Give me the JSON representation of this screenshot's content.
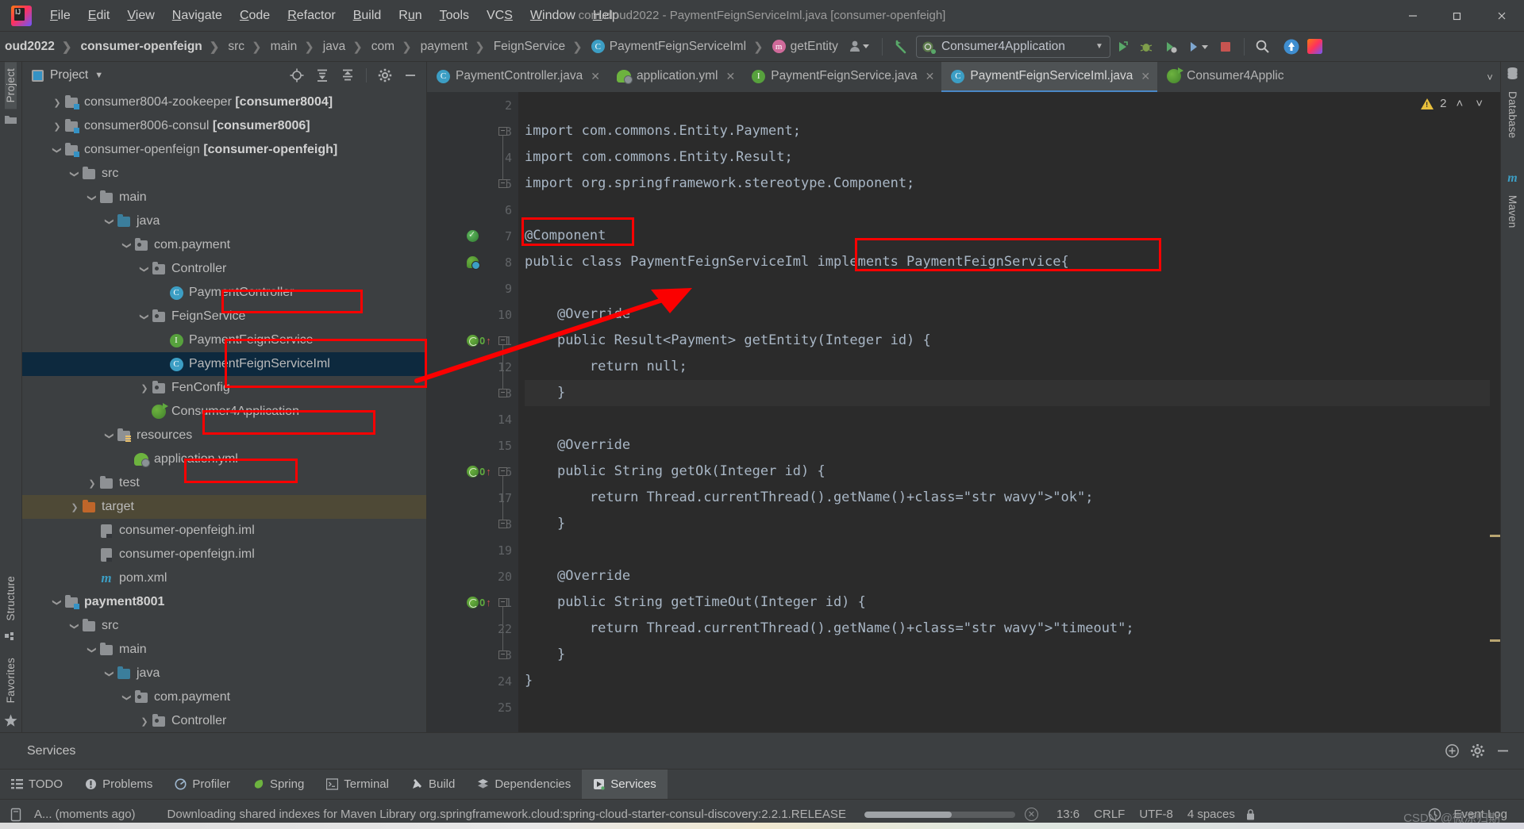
{
  "window": {
    "title": "com.cloud2022 - PaymentFeignServiceIml.java [consumer-openfeigh]",
    "minimize": "—",
    "maximize": "❐",
    "close": "✕"
  },
  "menu": {
    "items": [
      {
        "label": "File"
      },
      {
        "label": "Edit"
      },
      {
        "label": "View"
      },
      {
        "label": "Navigate"
      },
      {
        "label": "Code"
      },
      {
        "label": "Refactor"
      },
      {
        "label": "Build"
      },
      {
        "label": "Run"
      },
      {
        "label": "Tools"
      },
      {
        "label": "VCS"
      },
      {
        "label": "Window"
      },
      {
        "label": "Help"
      }
    ]
  },
  "breadcrumbs": [
    {
      "label": "oud2022",
      "bold": true,
      "icon": null
    },
    {
      "label": "consumer-openfeign",
      "bold": true,
      "icon": null
    },
    {
      "label": "src",
      "bold": false,
      "icon": null
    },
    {
      "label": "main",
      "bold": false,
      "icon": null
    },
    {
      "label": "java",
      "bold": false,
      "icon": null
    },
    {
      "label": "com",
      "bold": false,
      "icon": null
    },
    {
      "label": "payment",
      "bold": false,
      "icon": null
    },
    {
      "label": "FeignService",
      "bold": false,
      "icon": null
    },
    {
      "label": "PaymentFeignServiceIml",
      "bold": false,
      "icon": "class-icon"
    },
    {
      "label": "getEntity",
      "bold": false,
      "icon": "method-icon"
    }
  ],
  "toolbar": {
    "run_config": "Consumer4Application",
    "run_config_caret": "▼",
    "icons": [
      "user-icon",
      "back-arrow-icon",
      "run-icon",
      "debug-icon",
      "coverage-icon",
      "profile-icon",
      "stop-icon",
      "search-icon",
      "update-icon",
      "ide-icon"
    ]
  },
  "project_panel": {
    "title": "Project",
    "caret": "▼",
    "header_icons": [
      "locate-icon",
      "expand-all-icon",
      "collapse-all-icon",
      "gear-icon",
      "hide-icon"
    ],
    "tree": [
      {
        "depth": 1,
        "arrow": "collapsed",
        "icon": "module-icon",
        "label": "consumer8004-zookeeper ",
        "bold_suffix": "[consumer8004]"
      },
      {
        "depth": 1,
        "arrow": "collapsed",
        "icon": "module-icon",
        "label": "consumer8006-consul ",
        "bold_suffix": "[consumer8006]"
      },
      {
        "depth": 1,
        "arrow": "expanded",
        "icon": "module-icon",
        "label": "consumer-openfeign ",
        "bold_suffix": "[consumer-openfeigh]"
      },
      {
        "depth": 2,
        "arrow": "expanded",
        "icon": "folder-icon",
        "label": "src"
      },
      {
        "depth": 3,
        "arrow": "expanded",
        "icon": "folder-icon",
        "label": "main"
      },
      {
        "depth": 4,
        "arrow": "expanded",
        "icon": "source-folder-icon",
        "label": "java"
      },
      {
        "depth": 5,
        "arrow": "expanded",
        "icon": "package-icon",
        "label": "com.payment"
      },
      {
        "depth": 6,
        "arrow": "expanded",
        "icon": "package-icon",
        "label": "Controller"
      },
      {
        "depth": 7,
        "arrow": "none",
        "icon": "class-icon",
        "label": "PaymentController",
        "highlight": true
      },
      {
        "depth": 6,
        "arrow": "expanded",
        "icon": "package-icon",
        "label": "FeignService"
      },
      {
        "depth": 7,
        "arrow": "none",
        "icon": "interface-icon",
        "label": "PaymentFeignService",
        "highlight": true
      },
      {
        "depth": 7,
        "arrow": "none",
        "icon": "class-icon",
        "label": "PaymentFeignServiceIml",
        "selected": true,
        "highlight": true
      },
      {
        "depth": 6,
        "arrow": "collapsed",
        "icon": "package-icon",
        "label": "FenConfig"
      },
      {
        "depth": 6,
        "arrow": "none",
        "icon": "springboot-icon",
        "label": "Consumer4Application",
        "highlight": true
      },
      {
        "depth": 4,
        "arrow": "expanded",
        "icon": "resource-folder-icon",
        "label": "resources"
      },
      {
        "depth": 5,
        "arrow": "none",
        "icon": "yml-icon",
        "label": "application.yml",
        "highlight": true
      },
      {
        "depth": 3,
        "arrow": "collapsed",
        "icon": "folder-icon",
        "label": "test"
      },
      {
        "depth": 2,
        "arrow": "collapsed",
        "icon": "target-folder-icon",
        "label": "target",
        "selected2": true
      },
      {
        "depth": 3,
        "arrow": "none",
        "icon": "iml-icon",
        "label": "consumer-openfeigh.iml"
      },
      {
        "depth": 3,
        "arrow": "none",
        "icon": "iml-icon",
        "label": "consumer-openfeign.iml"
      },
      {
        "depth": 3,
        "arrow": "none",
        "icon": "maven-icon",
        "label": "pom.xml"
      },
      {
        "depth": 1,
        "arrow": "expanded",
        "icon": "module-icon",
        "label": "",
        "bold_suffix": "payment8001"
      },
      {
        "depth": 2,
        "arrow": "expanded",
        "icon": "folder-icon",
        "label": "src"
      },
      {
        "depth": 3,
        "arrow": "expanded",
        "icon": "folder-icon",
        "label": "main"
      },
      {
        "depth": 4,
        "arrow": "expanded",
        "icon": "source-folder-icon",
        "label": "java"
      },
      {
        "depth": 5,
        "arrow": "expanded",
        "icon": "package-icon",
        "label": "com.payment"
      },
      {
        "depth": 6,
        "arrow": "collapsed",
        "icon": "package-icon",
        "label": "Controller"
      }
    ]
  },
  "left_strip": {
    "items": [
      {
        "label": "Project",
        "icon": "folder-icon",
        "selected": true
      },
      {
        "label": "Structure",
        "icon": "structure-icon",
        "selected": false
      },
      {
        "label": "Favorites",
        "icon": "star-icon",
        "selected": false
      }
    ]
  },
  "right_strip": {
    "items": [
      {
        "label": "Database",
        "icon": "database-icon"
      },
      {
        "label": "Maven",
        "icon": "maven-icon"
      }
    ]
  },
  "editor_tabs": [
    {
      "label": "PaymentController.java",
      "icon": "class-icon",
      "active": false,
      "close": "✕"
    },
    {
      "label": "application.yml",
      "icon": "yml-icon",
      "active": false,
      "close": "✕"
    },
    {
      "label": "PaymentFeignService.java",
      "icon": "interface-icon",
      "active": false,
      "close": "✕"
    },
    {
      "label": "PaymentFeignServiceIml.java",
      "icon": "class-icon",
      "active": true,
      "close": "✕"
    },
    {
      "label": "Consumer4Applic",
      "icon": "springboot-icon",
      "active": false,
      "close": ""
    }
  ],
  "editor": {
    "warning_count": "2",
    "up_caret": "˄",
    "down_caret": "˅",
    "first_visible_line": 2,
    "lines": [
      {
        "n": 2,
        "text": ""
      },
      {
        "n": 3,
        "text": "import com.commons.Entity.Payment;"
      },
      {
        "n": 4,
        "text": "import com.commons.Entity.Result;"
      },
      {
        "n": 5,
        "text": "import org.springframework.stereotype.Component;"
      },
      {
        "n": 6,
        "text": ""
      },
      {
        "n": 7,
        "text": "@Component"
      },
      {
        "n": 8,
        "text": "public class PaymentFeignServiceIml implements PaymentFeignService{"
      },
      {
        "n": 9,
        "text": ""
      },
      {
        "n": 10,
        "text": "    @Override"
      },
      {
        "n": 11,
        "text": "    public Result<Payment> getEntity(Integer id) {"
      },
      {
        "n": 12,
        "text": "        return null;"
      },
      {
        "n": 13,
        "text": "    }"
      },
      {
        "n": 14,
        "text": ""
      },
      {
        "n": 15,
        "text": "    @Override"
      },
      {
        "n": 16,
        "text": "    public String getOk(Integer id) {"
      },
      {
        "n": 17,
        "text": "        return Thread.currentThread().getName()+\"ok\";"
      },
      {
        "n": 18,
        "text": "    }"
      },
      {
        "n": 19,
        "text": ""
      },
      {
        "n": 20,
        "text": "    @Override"
      },
      {
        "n": 21,
        "text": "    public String getTimeOut(Integer id) {"
      },
      {
        "n": 22,
        "text": "        return Thread.currentThread().getName()+\"timeout\";"
      },
      {
        "n": 23,
        "text": "    }"
      },
      {
        "n": 24,
        "text": "}"
      },
      {
        "n": 25,
        "text": ""
      }
    ]
  },
  "services": {
    "title": "Services",
    "icons": [
      "add-service-icon",
      "settings-icon",
      "hide-icon"
    ]
  },
  "bottom_tabs": [
    {
      "label": "TODO",
      "icon": "todo-icon",
      "active": false
    },
    {
      "label": "Problems",
      "icon": "problems-icon",
      "active": false
    },
    {
      "label": "Profiler",
      "icon": "profiler-icon",
      "active": false
    },
    {
      "label": "Spring",
      "icon": "spring-icon",
      "active": false
    },
    {
      "label": "Terminal",
      "icon": "terminal-icon",
      "active": false
    },
    {
      "label": "Build",
      "icon": "build-icon",
      "active": false
    },
    {
      "label": "Dependencies",
      "icon": "dependencies-icon",
      "active": false
    },
    {
      "label": "Services",
      "icon": "services-icon",
      "active": true
    }
  ],
  "status_bar": {
    "event_log": "Event Log",
    "event_log_icon": "event-log-icon",
    "notification_icon": "notification-icon",
    "notification": "A... (moments ago)",
    "message": "Downloading shared indexes for Maven Library org.springframework.cloud:spring-cloud-starter-consul-discovery:2.2.1.RELEASE",
    "progress_percent": 58,
    "cancel_icon": "cancel-icon",
    "caret_position": "13:6",
    "line_separator": "CRLF",
    "encoding": "UTF-8",
    "indent": "4 spaces",
    "lock_icon": "lock-icon",
    "watermark": "CSDN @微凉归期"
  },
  "annotations": {
    "boxes": [
      "@Component",
      "implements PaymentFeignService{",
      "PaymentController",
      "PaymentFeignService",
      "PaymentFeignServiceIml",
      "Consumer4Application",
      "application.yml"
    ],
    "arrow_color": "#fb0000"
  },
  "colors": {
    "accent": "#3592c4",
    "annotation_red": "#fb0000",
    "editor_bg": "#2b2b2b",
    "panel_bg": "#3c3f41",
    "selection": "#0d293e",
    "keyword": "#cc7832",
    "annotation_kw": "#bbb529",
    "string": "#6a8759",
    "method": "#ffc66d"
  }
}
